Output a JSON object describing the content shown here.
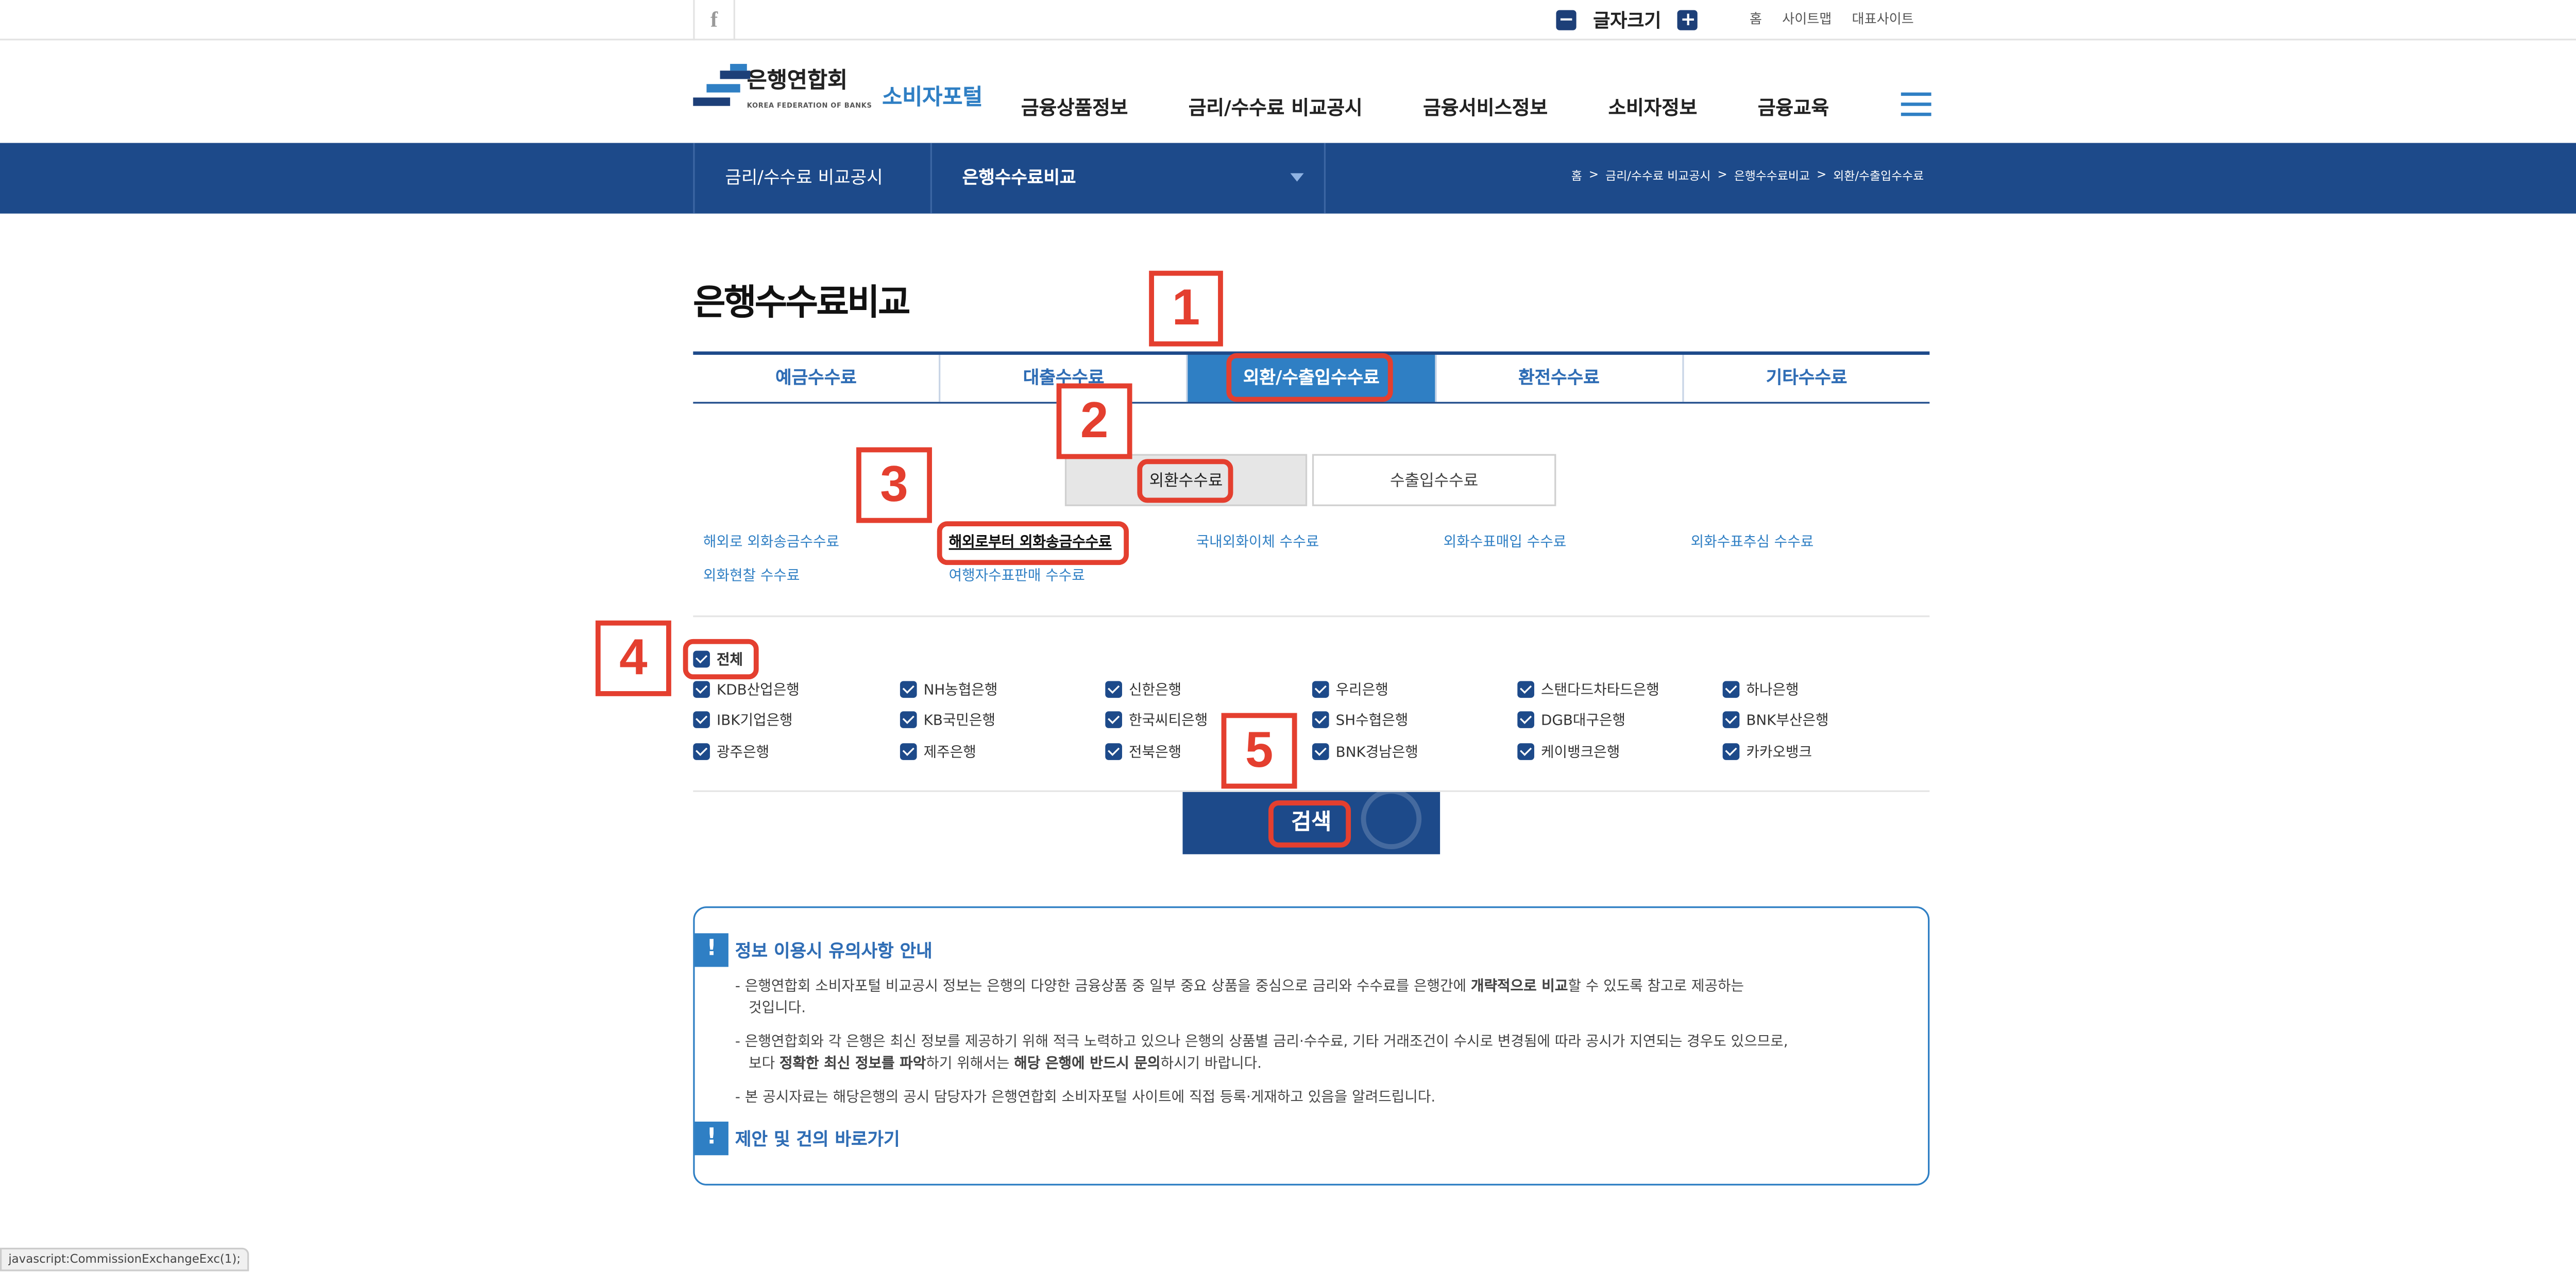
{
  "header": {
    "facebook_glyph": "f",
    "font_size_label": "글자크기",
    "font_minus": "−",
    "font_plus": "+",
    "top_links": [
      "홈",
      "사이트맵",
      "대표사이트"
    ]
  },
  "logo": {
    "org_name": "은행연합회",
    "org_sub": "KOREA FEDERATION OF BANKS",
    "portal_name": "소비자포털"
  },
  "gnb": [
    "금융상품정보",
    "금리/수수료 비교공시",
    "금융서비스정보",
    "소비자정보",
    "금융교육"
  ],
  "subnav": {
    "level1": "금리/수수료 비교공시",
    "level2": "은행수수료비교",
    "breadcrumb": [
      "홈",
      "금리/수수료 비교공시",
      "은행수수료비교",
      "외환/수출입수수료"
    ],
    "separator": ">"
  },
  "page_title": "은행수수료비교",
  "tabs": [
    "예금수수료",
    "대출수수료",
    "외환/수출입수수료",
    "환전수수료",
    "기타수수료"
  ],
  "subtabs": [
    "외환수수료",
    "수출입수수료"
  ],
  "fee_links": [
    "해외로 외화송금수수료",
    "해외로부터 외화송금수수료",
    "국내외화이체 수수료",
    "외화수표매입 수수료",
    "외화수표추심 수수료",
    "외화현찰 수수료",
    "여행자수표판매 수수료"
  ],
  "select_all_label": "전체",
  "banks": [
    "KDB산업은행",
    "NH농협은행",
    "신한은행",
    "우리은행",
    "스탠다드차타드은행",
    "하나은행",
    "IBK기업은행",
    "KB국민은행",
    "한국씨티은행",
    "SH수협은행",
    "DGB대구은행",
    "BNK부산은행",
    "광주은행",
    "제주은행",
    "전북은행",
    "BNK경남은행",
    "케이뱅크은행",
    "카카오뱅크"
  ],
  "search_label": "검색",
  "notice": {
    "icon": "!",
    "title": "정보 이용시 유의사항 안내",
    "lines": [
      {
        "pre": "은행연합회 소비자포털 비교공시 정보는 은행의 다양한 금융상품 중 일부 중요 상품을 중심으로 금리와 수수료를 은행간에 ",
        "bold": "개략적으로 비교",
        "post": "할 수 있도록 참고로 제공하는",
        "cont": "것입니다."
      },
      {
        "pre": "은행연합회와 각 은행은 최신 정보를 제공하기 위해 적극 노력하고 있으나 은행의 상품별 금리·수수료, 기타 거래조건이 수시로 변경됨에 따라 공시가 지연되는 경우도 있으므로,",
        "cont_pre": "보다 ",
        "bold": "정확한 최신 정보를 파악",
        "mid": "하기 위해서는 ",
        "bold2": "해당 은행에 반드시 문의",
        "post": "하시기 바랍니다."
      },
      {
        "pre": "본 공시자료는 해당은행의 공시 담당자가 은행연합회 소비자포털 사이트에 직접 등록·게재하고 있음을 알려드립니다."
      }
    ],
    "dash": "-",
    "proposal_title": "제안 및 건의 바로가기"
  },
  "annotations": [
    "1",
    "2",
    "3",
    "4",
    "5"
  ],
  "status_bar": "javascript:CommissionExchangeExc(1);"
}
